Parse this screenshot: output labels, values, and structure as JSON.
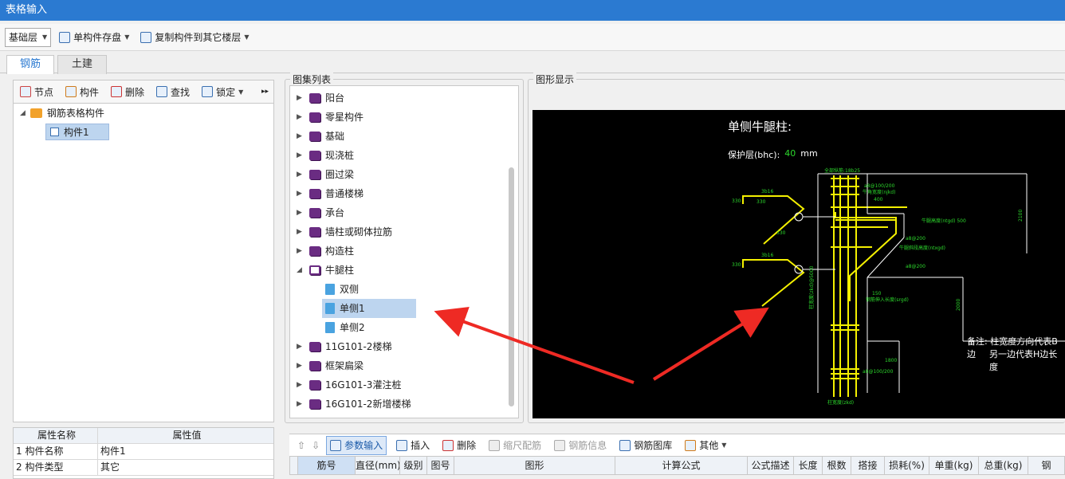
{
  "window": {
    "title": "表格输入"
  },
  "toolbar": {
    "floor": "基础层",
    "save_label": "单构件存盘",
    "copy_label": "复制构件到其它楼层"
  },
  "tabs": {
    "rebar": "钢筋",
    "civil": "土建"
  },
  "left_toolbar": {
    "node": "节点",
    "component": "构件",
    "delete": "删除",
    "find": "查找",
    "lock": "锁定",
    "more": "▸▸"
  },
  "tree": {
    "root": "钢筋表格构件",
    "child": "构件1"
  },
  "props": {
    "header_name": "属性名称",
    "header_value": "属性值",
    "rows": [
      {
        "idx": "1",
        "name": "构件名称",
        "value": "构件1"
      },
      {
        "idx": "2",
        "name": "构件类型",
        "value": "其它"
      }
    ]
  },
  "atlas": {
    "title": "图集列表",
    "items": [
      "阳台",
      "零星构件",
      "基础",
      "现浇桩",
      "圈过梁",
      "普通楼梯",
      "承台",
      "墙柱或砌体拉筋",
      "构造柱",
      "牛腿柱"
    ],
    "children": [
      "双侧",
      "单侧1",
      "单侧2"
    ],
    "items_after": [
      "11G101-2楼梯",
      "框架扁梁",
      "16G101-3灌注桩",
      "16G101-2新增楼梯"
    ]
  },
  "graphic": {
    "title": "图形显示",
    "drawing_title": "单侧牛腿柱:",
    "cover_label": "保护层(bhc):",
    "cover_value": "40",
    "cover_unit": "mm",
    "note_line1": "备注: 柱宽度方向代表B边",
    "note_line2": "另一边代表H边长度",
    "labels": {
      "zhujin": "全部纵筋:18b25",
      "stirrup1": "a8@100/200",
      "nj_width": "牛角宽度(njkd)",
      "nj_400": "400",
      "ntgd": "牛腿高度(ntgd) 500",
      "a200a": "a8@200",
      "xbgd": "牛腿斜段高度(ntxgd)",
      "a200b": "a8@200",
      "v330": "330",
      "v3b16": "3b16",
      "v3b16b": "3b16",
      "v330b": "330",
      "v330c": "330",
      "v330d": "330",
      "v150": "150",
      "gjsr": "钢筋伸入长度(srgd)",
      "v2100": "2100",
      "v2000": "2000",
      "v1800": "1800",
      "stirrup2": "a8@100/200",
      "zkd": "柱宽度(zkd)",
      "side_h": "柱宽度(zkd)@5000"
    }
  },
  "bottom_toolbar": {
    "param_input": "参数输入",
    "insert": "插入",
    "delete": "删除",
    "scale": "缩尺配筋",
    "info": "钢筋信息",
    "library": "钢筋图库",
    "other": "其他"
  },
  "grid_headers": [
    "筋号",
    "直径(mm)",
    "级别",
    "图号",
    "图形",
    "计算公式",
    "公式描述",
    "长度",
    "根数",
    "搭接",
    "损耗(%)",
    "单重(kg)",
    "总重(kg)",
    "钢"
  ]
}
